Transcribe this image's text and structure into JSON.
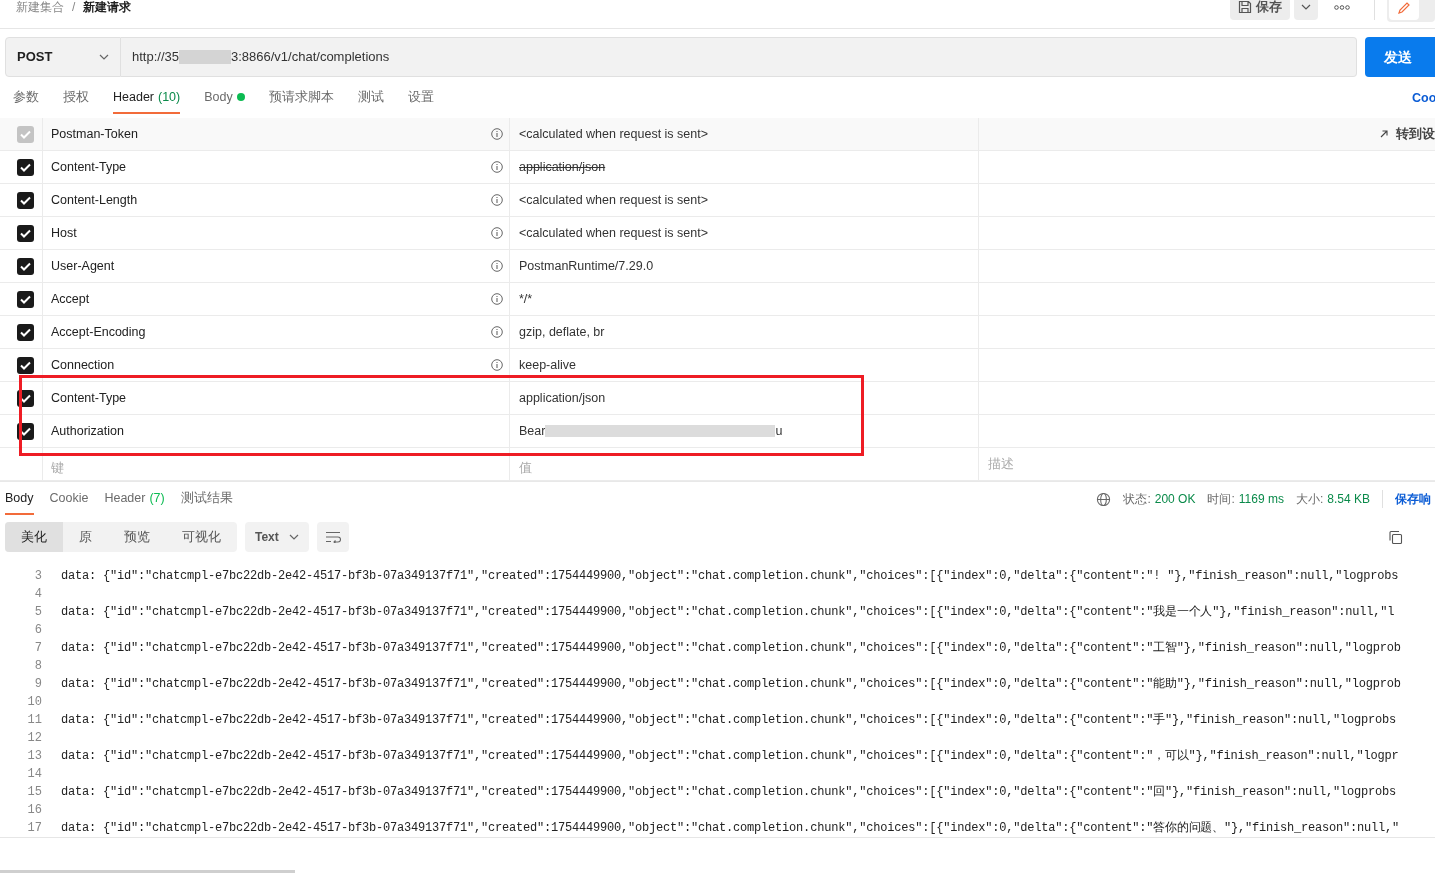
{
  "breadcrumb": [
    "新建集合",
    "/",
    "新建请求"
  ],
  "toolbar": {
    "save_label": "保存"
  },
  "request": {
    "method": "POST",
    "url_parts": [
      "http://35",
      "3:8866/v1/chat/completions"
    ],
    "send_label": "发送"
  },
  "request_tabs": [
    {
      "label": "参数",
      "selected": false
    },
    {
      "label": "授权",
      "selected": false
    },
    {
      "label": "Header",
      "count": "(10)",
      "selected": true
    },
    {
      "label": "Body",
      "dot": true,
      "selected": false
    },
    {
      "label": "预请求脚本",
      "selected": false
    },
    {
      "label": "测试",
      "selected": false
    },
    {
      "label": "设置",
      "selected": false
    }
  ],
  "cookies_link": "Coo",
  "headers": {
    "go_to_label": "转到设",
    "rows": [
      {
        "key": "Postman-Token",
        "value_parts": [
          "<calculated when request is sent>"
        ],
        "checked": true,
        "disabled": true,
        "info": true,
        "strikethrough": false
      },
      {
        "key": "Content-Type",
        "value_parts": [
          "application/json"
        ],
        "checked": true,
        "disabled": false,
        "info": true,
        "strikethrough": true
      },
      {
        "key": "Content-Length",
        "value_parts": [
          "<calculated when request is sent>"
        ],
        "checked": true,
        "disabled": false,
        "info": true,
        "strikethrough": false
      },
      {
        "key": "Host",
        "value_parts": [
          "<calculated when request is sent>"
        ],
        "checked": true,
        "disabled": false,
        "info": true,
        "strikethrough": false
      },
      {
        "key": "User-Agent",
        "value_parts": [
          "PostmanRuntime/7.29.0"
        ],
        "checked": true,
        "disabled": false,
        "info": true,
        "strikethrough": false
      },
      {
        "key": "Accept",
        "value_parts": [
          "*/*"
        ],
        "checked": true,
        "disabled": false,
        "info": true,
        "strikethrough": false
      },
      {
        "key": "Accept-Encoding",
        "value_parts": [
          "gzip, deflate, br"
        ],
        "checked": true,
        "disabled": false,
        "info": true,
        "strikethrough": false
      },
      {
        "key": "Connection",
        "value_parts": [
          "keep-alive"
        ],
        "checked": true,
        "disabled": false,
        "info": true,
        "strikethrough": false
      },
      {
        "key": "Content-Type",
        "value_parts": [
          "application/json"
        ],
        "checked": true,
        "disabled": false,
        "info": false,
        "strikethrough": false
      },
      {
        "key": "Authorization",
        "value_parts": [
          "Bear",
          "u"
        ],
        "checked": true,
        "disabled": false,
        "info": false,
        "strikethrough": false
      }
    ],
    "placeholder": {
      "key": "键",
      "value": "值",
      "description": "描述"
    }
  },
  "response_tabs": [
    {
      "label": "Body",
      "selected": true
    },
    {
      "label": "Cookie",
      "selected": false
    },
    {
      "label": "Header",
      "count": "(7)",
      "selected": false
    },
    {
      "label": "测试结果",
      "selected": false
    }
  ],
  "response_meta": [
    {
      "label": "状态:",
      "value": "200 OK"
    },
    {
      "label": "时间:",
      "value": "1169 ms"
    },
    {
      "label": "大小:",
      "value": "8.54 KB"
    }
  ],
  "save_response": "保存响",
  "view_modes": [
    {
      "label": "美化",
      "selected": true
    },
    {
      "label": "原",
      "selected": false
    },
    {
      "label": "预览",
      "selected": false
    },
    {
      "label": "可视化",
      "selected": false
    }
  ],
  "format": "Text",
  "code_lines": [
    {
      "num": "3",
      "text": "data: {\"id\":\"chatcmpl-e7bc22db-2e42-4517-bf3b-07a349137f71\",\"created\":1754449900,\"object\":\"chat.completion.chunk\",\"choices\":[{\"index\":0,\"delta\":{\"content\":\"! \"},\"finish_reason\":null,\"logprobs"
    },
    {
      "num": "4"
    },
    {
      "num": "5",
      "text": "data: {\"id\":\"chatcmpl-e7bc22db-2e42-4517-bf3b-07a349137f71\",\"created\":1754449900,\"object\":\"chat.completion.chunk\",\"choices\":[{\"index\":0,\"delta\":{\"content\":\"我是一个人\"},\"finish_reason\":null,\"l"
    },
    {
      "num": "6"
    },
    {
      "num": "7",
      "text": "data: {\"id\":\"chatcmpl-e7bc22db-2e42-4517-bf3b-07a349137f71\",\"created\":1754449900,\"object\":\"chat.completion.chunk\",\"choices\":[{\"index\":0,\"delta\":{\"content\":\"工智\"},\"finish_reason\":null,\"logprob"
    },
    {
      "num": "8"
    },
    {
      "num": "9",
      "text": "data: {\"id\":\"chatcmpl-e7bc22db-2e42-4517-bf3b-07a349137f71\",\"created\":1754449900,\"object\":\"chat.completion.chunk\",\"choices\":[{\"index\":0,\"delta\":{\"content\":\"能助\"},\"finish_reason\":null,\"logprob"
    },
    {
      "num": "10"
    },
    {
      "num": "11",
      "text": "data: {\"id\":\"chatcmpl-e7bc22db-2e42-4517-bf3b-07a349137f71\",\"created\":1754449900,\"object\":\"chat.completion.chunk\",\"choices\":[{\"index\":0,\"delta\":{\"content\":\"手\"},\"finish_reason\":null,\"logprobs"
    },
    {
      "num": "12"
    },
    {
      "num": "13",
      "text": "data: {\"id\":\"chatcmpl-e7bc22db-2e42-4517-bf3b-07a349137f71\",\"created\":1754449900,\"object\":\"chat.completion.chunk\",\"choices\":[{\"index\":0,\"delta\":{\"content\":\"，可以\"},\"finish_reason\":null,\"logpr"
    },
    {
      "num": "14"
    },
    {
      "num": "15",
      "text": "data: {\"id\":\"chatcmpl-e7bc22db-2e42-4517-bf3b-07a349137f71\",\"created\":1754449900,\"object\":\"chat.completion.chunk\",\"choices\":[{\"index\":0,\"delta\":{\"content\":\"回\"},\"finish_reason\":null,\"logprobs"
    },
    {
      "num": "16"
    },
    {
      "num": "17",
      "text": "data: {\"id\":\"chatcmpl-e7bc22db-2e42-4517-bf3b-07a349137f71\",\"created\":1754449900,\"object\":\"chat.completion.chunk\",\"choices\":[{\"index\":0,\"delta\":{\"content\":\"答你的问题、\"},\"finish_reason\":null,\""
    }
  ]
}
